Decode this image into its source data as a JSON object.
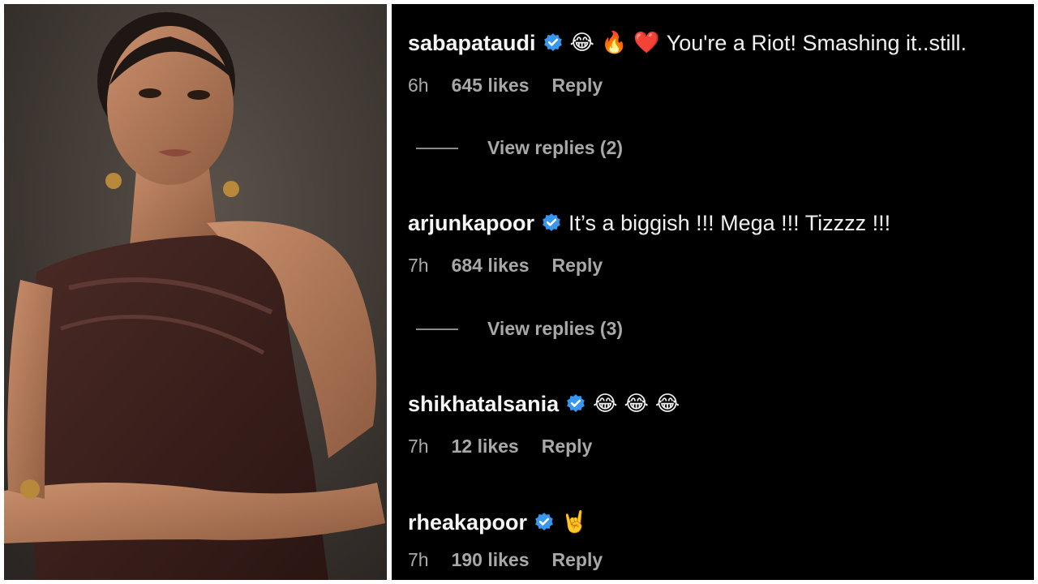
{
  "comments": [
    {
      "username": "sabapataudi",
      "verified": true,
      "emojis": [
        "😂",
        "🔥",
        "❤️"
      ],
      "text": "You're a Riot! Smashing it..still.",
      "time": "6h",
      "likes": "645 likes",
      "reply_label": "Reply",
      "view_replies": "View replies (2)"
    },
    {
      "username": "arjunkapoor",
      "verified": true,
      "emojis": [],
      "text": "It’s a biggish !!! Mega !!! Tizzzz !!!",
      "time": "7h",
      "likes": "684 likes",
      "reply_label": "Reply",
      "view_replies": "View replies (3)"
    },
    {
      "username": "shikhatalsania",
      "verified": true,
      "emojis": [
        "😂",
        "😂",
        "😂"
      ],
      "text": "",
      "time": "7h",
      "likes": "12 likes",
      "reply_label": "Reply"
    },
    {
      "username": "rheakapoor",
      "verified": true,
      "emojis": [
        "🤘"
      ],
      "text": "",
      "time": "7h",
      "likes": "190 likes",
      "reply_label": "Reply"
    }
  ],
  "colors": {
    "panel_bg": "#000000",
    "verified_blue": "#3897f0",
    "meta_gray": "#a8a8a8"
  },
  "icons": {
    "verified": "verified-badge-icon",
    "reply_line": "thread-line"
  }
}
